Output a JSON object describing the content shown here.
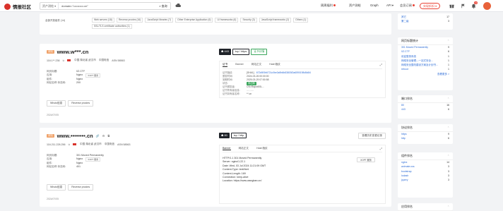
{
  "topbar": {
    "logo_text": "情报社区",
    "search_scope": "资产测绘 ▾",
    "search_text": "domain=\"••••••••••.cn\"",
    "search_btn": "⌕ 查询",
    "nav": [
      {
        "label": "周周福利",
        "hot": true
      },
      {
        "label": "资产测绘",
        "hot": false
      },
      {
        "label": "Graph",
        "hot": false
      },
      {
        "label": "API ▾",
        "hot": false
      },
      {
        "label": "会员订阅",
        "hot": true
      }
    ],
    "member_label": "实现折扣 ▾",
    "badge_count": "12"
  },
  "filter_card": {
    "chips_row1": [
      "全部开放组件 (14)",
      "Web servers (18)",
      "Reverse proxies (16)",
      "JavaScript libraries (7)",
      "Other Enterprise Application (6)",
      "UI frameworks (6)",
      "Security (3)",
      "JavaScript frameworks (2)",
      "Others (1)"
    ],
    "chips_row2": "SSL/TLS certificate authorities (1)"
  },
  "result1": {
    "tag": "未知",
    "domain": "www.w***.cn",
    "ip": "116.1**.236",
    "location": "中国 湖北省 武汉市",
    "isp": "中国电信",
    "asn": "ASN 58563",
    "fields": [
      {
        "k": "网页标题:",
        "v": "0Z.CTF"
      },
      {
        "k": "应用:",
        "v": "Nginx",
        "extra": "XOPT 服务"
      },
      {
        "k": "组件:",
        "v": "Nginx"
      },
      {
        "k": "网站名称·状态码:",
        "v": "200"
      }
    ],
    "btn_whois": "Whois信息",
    "btn_proxies": "Reverse proxies",
    "date": "2024/07/05",
    "ports": [
      "443",
      "tcp / https",
      "证书详情"
    ],
    "tabs": [
      "证书",
      "Banner",
      "网站正文",
      "Hash指纹"
    ],
    "cert": [
      {
        "k": "证书指纹:",
        "v": "[SHA1]",
        "v2": "672d5f3b6721c0be3a9b6b83803f2a6590198d5d84"
      },
      {
        "k": "颁发时间:",
        "v": "2024-03-26 00:00:00"
      },
      {
        "k": "到期时间:",
        "v": "2025-03-29 07:50:58"
      },
      {
        "k": "状态:",
        "v": "未过期"
      },
      {
        "k": "证书颁发者:",
        "v": "CN=RapidSSL..."
      },
      {
        "k": "证书所有者信息:",
        "v": "………"
      },
      {
        "k": "证书持有者名称:",
        "v": "**.cn"
      }
    ]
  },
  "result2": {
    "tag": "未知",
    "domain": "www.••••••••.cn",
    "ip": "116.211.228.256",
    "location": "中国 湖北省 武汉市",
    "isp": "中国电信",
    "asn": "ASN 58563",
    "fields": [
      {
        "k": "网页标题:",
        "v": "301 Moved Permanently"
      },
      {
        "k": "应用:",
        "v": "Nginx",
        "extra": "XOPT 服务"
      },
      {
        "k": "组件:",
        "v": "Nginx"
      },
      {
        "k": "网站名称·状态码:",
        "v": "401"
      }
    ],
    "btn_whois": "Whois信息",
    "btn_proxies": "Reverse proxies",
    "date": "2024/07/05",
    "ports": [
      "80",
      "tcp / http"
    ],
    "port_action": "查看历史变更记录",
    "tabs": [
      "Banner",
      "网站正文",
      "Hash指纹"
    ],
    "banner_btn": "XOPT 服务",
    "http_lines": [
      "HTTP/1.1 301 Moved Permanently",
      "Server: nginx/1.22.1",
      "Date: Wed, 03 Jul 2024 11:21:09 GMT",
      "Content-Type: text/html",
      "Content-Length: 169",
      "Connection: keep-alive",
      "Location: https://www.wangban.cn/"
    ]
  },
  "sidebar": {
    "top_items": [
      {
        "label": "其它",
        "value": "17",
        "link": true
      },
      {
        "label": "第二级",
        "value": "3",
        "link": true
      }
    ],
    "title_count": "网页标题统计",
    "title_items": [
      {
        "label": "301 Moved Permanently",
        "value": "9"
      },
      {
        "label": "0Z.CTF",
        "value": "6"
      },
      {
        "label": "欢迎登录系统",
        "value": "1"
      },
      {
        "label": "网络安全管理---一站式安全...",
        "value": "1"
      },
      {
        "label": "网络安全整改建设方案及计划书...",
        "value": "1"
      },
      {
        "label": "reboot",
        "value": "1"
      }
    ],
    "more": "查看更多 >",
    "port_title": "端口排名",
    "ports": [
      {
        "label": "80",
        "value": "16"
      },
      {
        "label": "443",
        "value": "6"
      }
    ],
    "proto_title": "协议排名",
    "protos": [
      {
        "label": "https",
        "value": "9"
      },
      {
        "label": "http",
        "value": "6"
      }
    ],
    "comp_title": "组件排名",
    "comps": [
      {
        "label": "nginx",
        "value": "14"
      },
      {
        "label": "animate.css",
        "value": "3"
      },
      {
        "label": "bootstrap",
        "value": "3"
      },
      {
        "label": "lodash",
        "value": "3"
      },
      {
        "label": "jquery",
        "value": "3"
      }
    ],
    "app_title": "应用排名"
  }
}
